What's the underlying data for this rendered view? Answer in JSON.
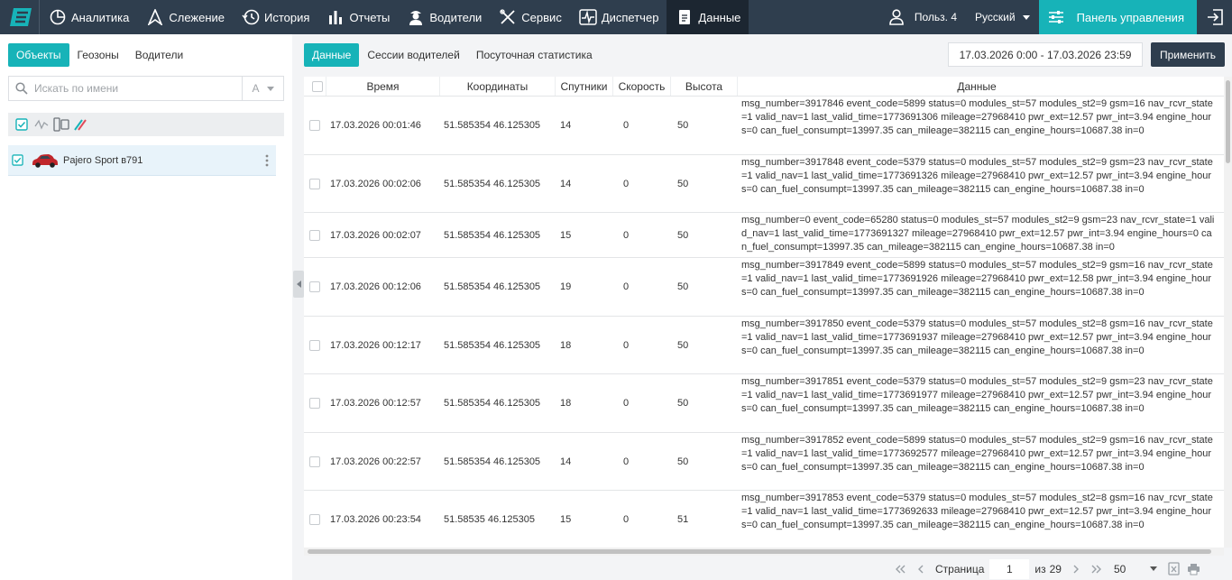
{
  "nav": {
    "items": [
      {
        "label": "Аналитика",
        "icon": "analytics-icon"
      },
      {
        "label": "Слежение",
        "icon": "tracking-icon"
      },
      {
        "label": "История",
        "icon": "history-icon"
      },
      {
        "label": "Отчеты",
        "icon": "reports-icon"
      },
      {
        "label": "Водители",
        "icon": "drivers-icon"
      },
      {
        "label": "Сервис",
        "icon": "service-icon"
      },
      {
        "label": "Диспетчер",
        "icon": "dispatcher-icon"
      },
      {
        "label": "Данные",
        "icon": "data-icon"
      }
    ],
    "active": "Данные",
    "user": "Польз. 4",
    "language": "Русский",
    "control_panel": "Панель управления"
  },
  "left": {
    "tabs": [
      "Объекты",
      "Геозоны",
      "Водители"
    ],
    "active_tab": "Объекты",
    "search_placeholder": "Искать по имени",
    "sort_label": "A",
    "object": {
      "name": "Pajero Sport в791"
    }
  },
  "right": {
    "tabs": [
      "Данные",
      "Сессии водителей",
      "Посуточная статистика"
    ],
    "active_tab": "Данные",
    "date_range": "17.03.2026 0:00 - 17.03.2026 23:59",
    "apply_label": "Применить",
    "columns": [
      "Время",
      "Координаты",
      "Спутники",
      "Скорость",
      "Высота",
      "Данные"
    ],
    "rows": [
      {
        "time": "17.03.2026 00:01:46",
        "coords": "51.585354 46.125305",
        "sat": "14",
        "speed": "0",
        "alt": "50",
        "data": "msg_number=3917846 event_code=5899 status=0 modules_st=57 modules_st2=9 gsm=16 nav_rcvr_state=1 valid_nav=1 last_valid_time=1773691306 mileage=27968410 pwr_ext=12.57 pwr_int=3.94 engine_hours=0 can_fuel_consumpt=13997.35 can_mileage=382115 can_engine_hours=10687.38 in=0"
      },
      {
        "time": "17.03.2026 00:02:06",
        "coords": "51.585354 46.125305",
        "sat": "14",
        "speed": "0",
        "alt": "50",
        "data": "msg_number=3917848 event_code=5379 status=0 modules_st=57 modules_st2=9 gsm=23 nav_rcvr_state=1 valid_nav=1 last_valid_time=1773691326 mileage=27968410 pwr_ext=12.57 pwr_int=3.94 engine_hours=0 can_fuel_consumpt=13997.35 can_mileage=382115 can_engine_hours=10687.38 in=0"
      },
      {
        "time": "17.03.2026 00:02:07",
        "coords": "51.585354 46.125305",
        "sat": "15",
        "speed": "0",
        "alt": "50",
        "data": "msg_number=0 event_code=65280 status=0 modules_st=57 modules_st2=9 gsm=23 nav_rcvr_state=1 valid_nav=1 last_valid_time=1773691327 mileage=27968410 pwr_ext=12.57 pwr_int=3.94 engine_hours=0 can_fuel_consumpt=13997.35 can_mileage=382115 can_engine_hours=10687.38 in=0"
      },
      {
        "time": "17.03.2026 00:12:06",
        "coords": "51.585354 46.125305",
        "sat": "19",
        "speed": "0",
        "alt": "50",
        "data": "msg_number=3917849 event_code=5899 status=0 modules_st=57 modules_st2=9 gsm=16 nav_rcvr_state=1 valid_nav=1 last_valid_time=1773691926 mileage=27968410 pwr_ext=12.58 pwr_int=3.94 engine_hours=0 can_fuel_consumpt=13997.35 can_mileage=382115 can_engine_hours=10687.38 in=0"
      },
      {
        "time": "17.03.2026 00:12:17",
        "coords": "51.585354 46.125305",
        "sat": "18",
        "speed": "0",
        "alt": "50",
        "data": "msg_number=3917850 event_code=5379 status=0 modules_st=57 modules_st2=8 gsm=16 nav_rcvr_state=1 valid_nav=1 last_valid_time=1773691937 mileage=27968410 pwr_ext=12.57 pwr_int=3.94 engine_hours=0 can_fuel_consumpt=13997.35 can_mileage=382115 can_engine_hours=10687.38 in=0"
      },
      {
        "time": "17.03.2026 00:12:57",
        "coords": "51.585354 46.125305",
        "sat": "18",
        "speed": "0",
        "alt": "50",
        "data": "msg_number=3917851 event_code=5379 status=0 modules_st=57 modules_st2=9 gsm=23 nav_rcvr_state=1 valid_nav=1 last_valid_time=1773691977 mileage=27968410 pwr_ext=12.57 pwr_int=3.94 engine_hours=0 can_fuel_consumpt=13997.35 can_mileage=382115 can_engine_hours=10687.38 in=0"
      },
      {
        "time": "17.03.2026 00:22:57",
        "coords": "51.585354 46.125305",
        "sat": "14",
        "speed": "0",
        "alt": "50",
        "data": "msg_number=3917852 event_code=5899 status=0 modules_st=57 modules_st2=9 gsm=16 nav_rcvr_state=1 valid_nav=1 last_valid_time=1773692577 mileage=27968410 pwr_ext=12.57 pwr_int=3.94 engine_hours=0 can_fuel_consumpt=13997.35 can_mileage=382115 can_engine_hours=10687.38 in=0"
      },
      {
        "time": "17.03.2026 00:23:54",
        "coords": "51.58535 46.125305",
        "sat": "15",
        "speed": "0",
        "alt": "51",
        "data": "msg_number=3917853 event_code=5379 status=0 modules_st=57 modules_st2=8 gsm=16 nav_rcvr_state=1 valid_nav=1 last_valid_time=1773692633 mileage=27968410 pwr_ext=12.57 pwr_int=3.94 engine_hours=0 can_fuel_consumpt=13997.35 can_mileage=382115 can_engine_hours=10687.38 in=0"
      }
    ]
  },
  "pager": {
    "page_label": "Страница",
    "page": "1",
    "of_label": "из",
    "total": "29",
    "page_size": "50"
  },
  "colors": {
    "accent": "#17b3b8",
    "nav_bg": "#2f3e4e",
    "nav_active": "#1c2631"
  }
}
